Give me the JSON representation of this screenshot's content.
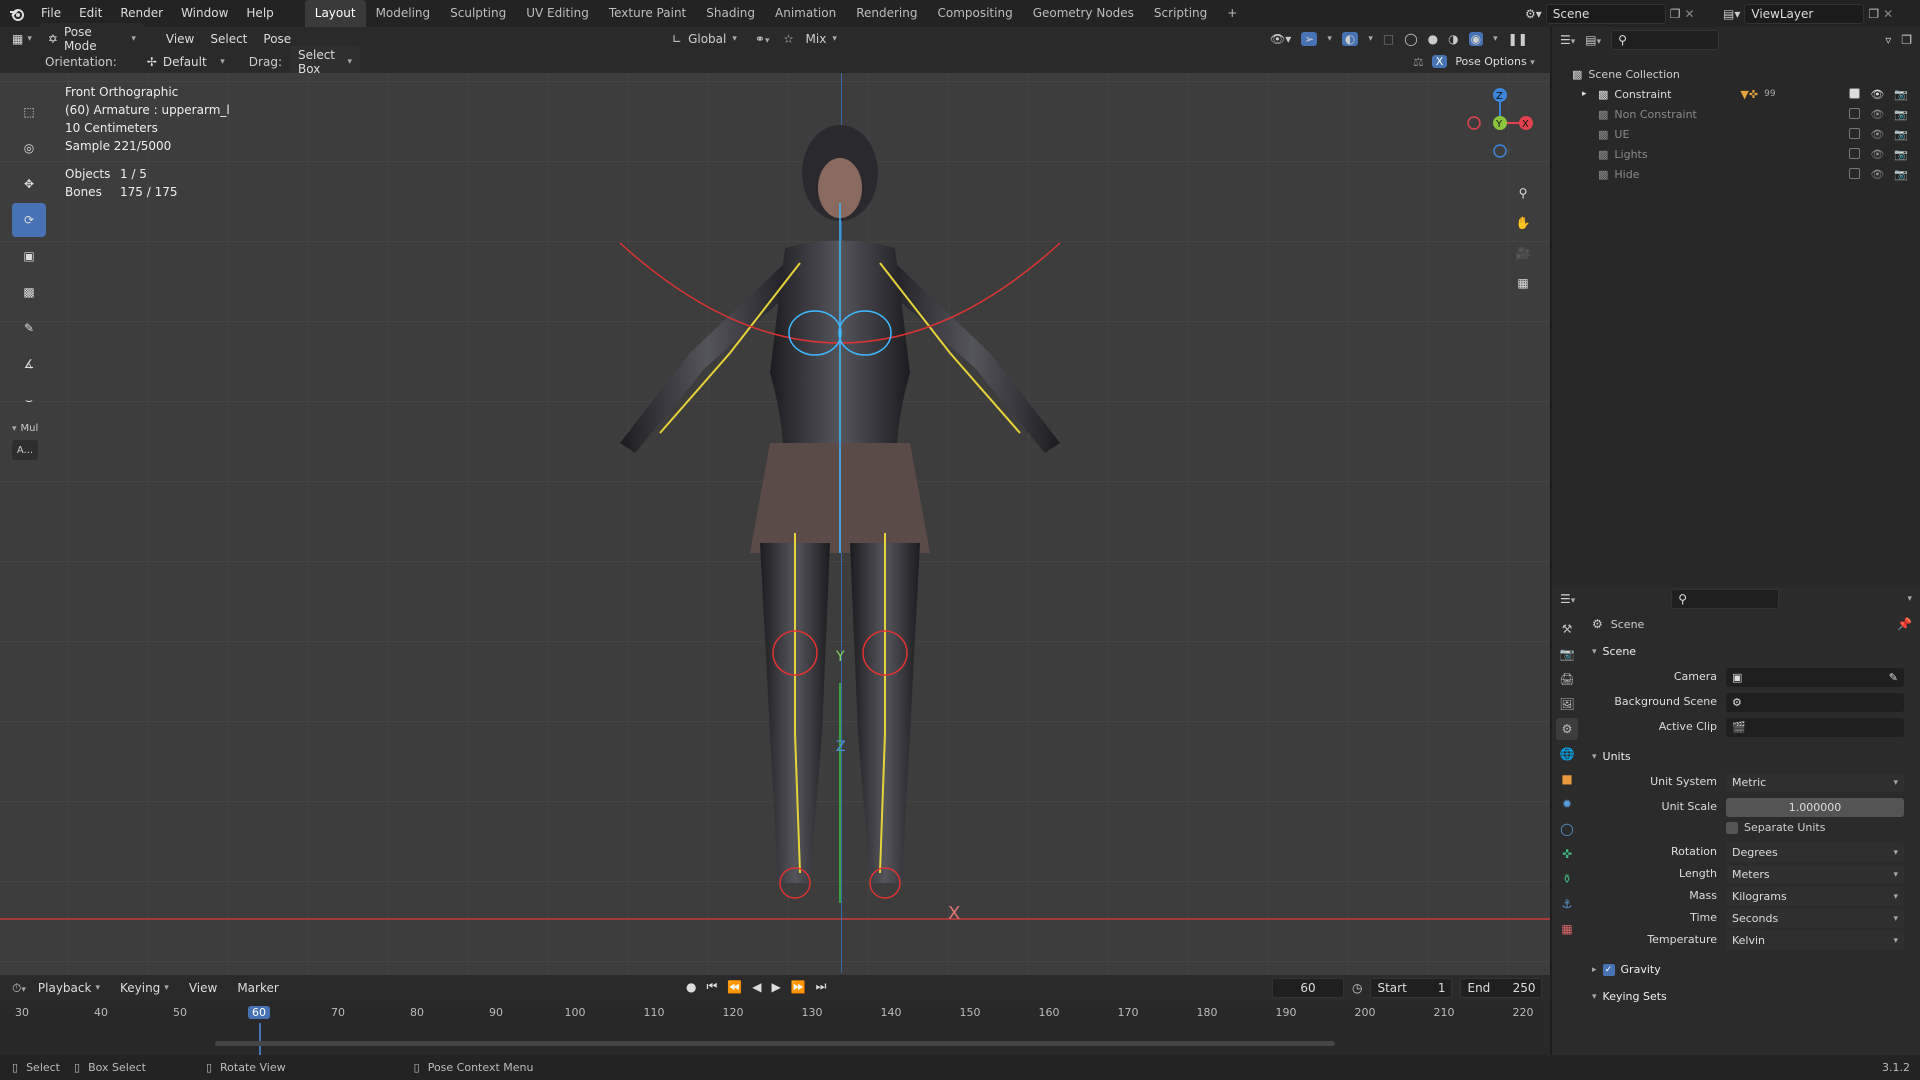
{
  "app_menu": [
    "File",
    "Edit",
    "Render",
    "Window",
    "Help"
  ],
  "workspaces": [
    "Layout",
    "Modeling",
    "Sculpting",
    "UV Editing",
    "Texture Paint",
    "Shading",
    "Animation",
    "Rendering",
    "Compositing",
    "Geometry Nodes",
    "Scripting"
  ],
  "active_workspace": "Layout",
  "scene_name": "Scene",
  "view_layer": "ViewLayer",
  "header": {
    "mode": "Pose Mode",
    "view": "View",
    "select": "Select",
    "pose": "Pose",
    "transform_orientation": "Global",
    "pivot": "Mix",
    "orientation_label": "Orientation:",
    "orientation_value": "Default",
    "drag_label": "Drag:",
    "drag_value": "Select Box",
    "pose_options": "Pose Options",
    "x_mirror": "X"
  },
  "viewport": {
    "view_name": "Front Orthographic",
    "active": "(60) Armature : upperarm_l",
    "scale": "10 Centimeters",
    "sample": "Sample 221/5000",
    "objects_label": "Objects",
    "objects_value": "1 / 5",
    "bones_label": "Bones",
    "bones_value": "175 / 175",
    "axis_z": "Z",
    "axis_y": "Y",
    "axis_x": "X",
    "panel_label": "Mul",
    "panel_btn": "A..."
  },
  "timeline": {
    "menus": [
      "Playback",
      "Keying",
      "View",
      "Marker"
    ],
    "current_frame": "60",
    "start_label": "Start",
    "start": "1",
    "end_label": "End",
    "end": "250",
    "ruler": [
      "30",
      "40",
      "50",
      "60",
      "70",
      "80",
      "90",
      "100",
      "110",
      "120",
      "130",
      "140",
      "150",
      "160",
      "170",
      "180",
      "190",
      "200",
      "210",
      "220"
    ]
  },
  "statusbar": {
    "select": "Select",
    "box_select": "Box Select",
    "rotate_view": "Rotate View",
    "context_menu": "Pose Context Menu",
    "version": "3.1.2"
  },
  "outliner": {
    "root": "Scene Collection",
    "items": [
      {
        "name": "Constraint",
        "active": true,
        "badge": "99"
      },
      {
        "name": "Non Constraint",
        "active": false
      },
      {
        "name": "UE",
        "active": false
      },
      {
        "name": "Lights",
        "active": false
      },
      {
        "name": "Hide",
        "active": false
      }
    ]
  },
  "properties": {
    "context": "Scene",
    "scene_section": "Scene",
    "camera_label": "Camera",
    "bg_scene_label": "Background Scene",
    "active_clip_label": "Active Clip",
    "units_section": "Units",
    "unit_system_label": "Unit System",
    "unit_system": "Metric",
    "unit_scale_label": "Unit Scale",
    "unit_scale": "1.000000",
    "separate_units": "Separate Units",
    "rotation_label": "Rotation",
    "rotation": "Degrees",
    "length_label": "Length",
    "length": "Meters",
    "mass_label": "Mass",
    "mass": "Kilograms",
    "time_label": "Time",
    "time": "Seconds",
    "temperature_label": "Temperature",
    "temperature": "Kelvin",
    "gravity": "Gravity",
    "keying_sets": "Keying Sets"
  },
  "colors": {
    "accent": "#4772b3",
    "axis_x": "#e2424d",
    "axis_y": "#8bc33c",
    "axis_z": "#3c85d8"
  }
}
